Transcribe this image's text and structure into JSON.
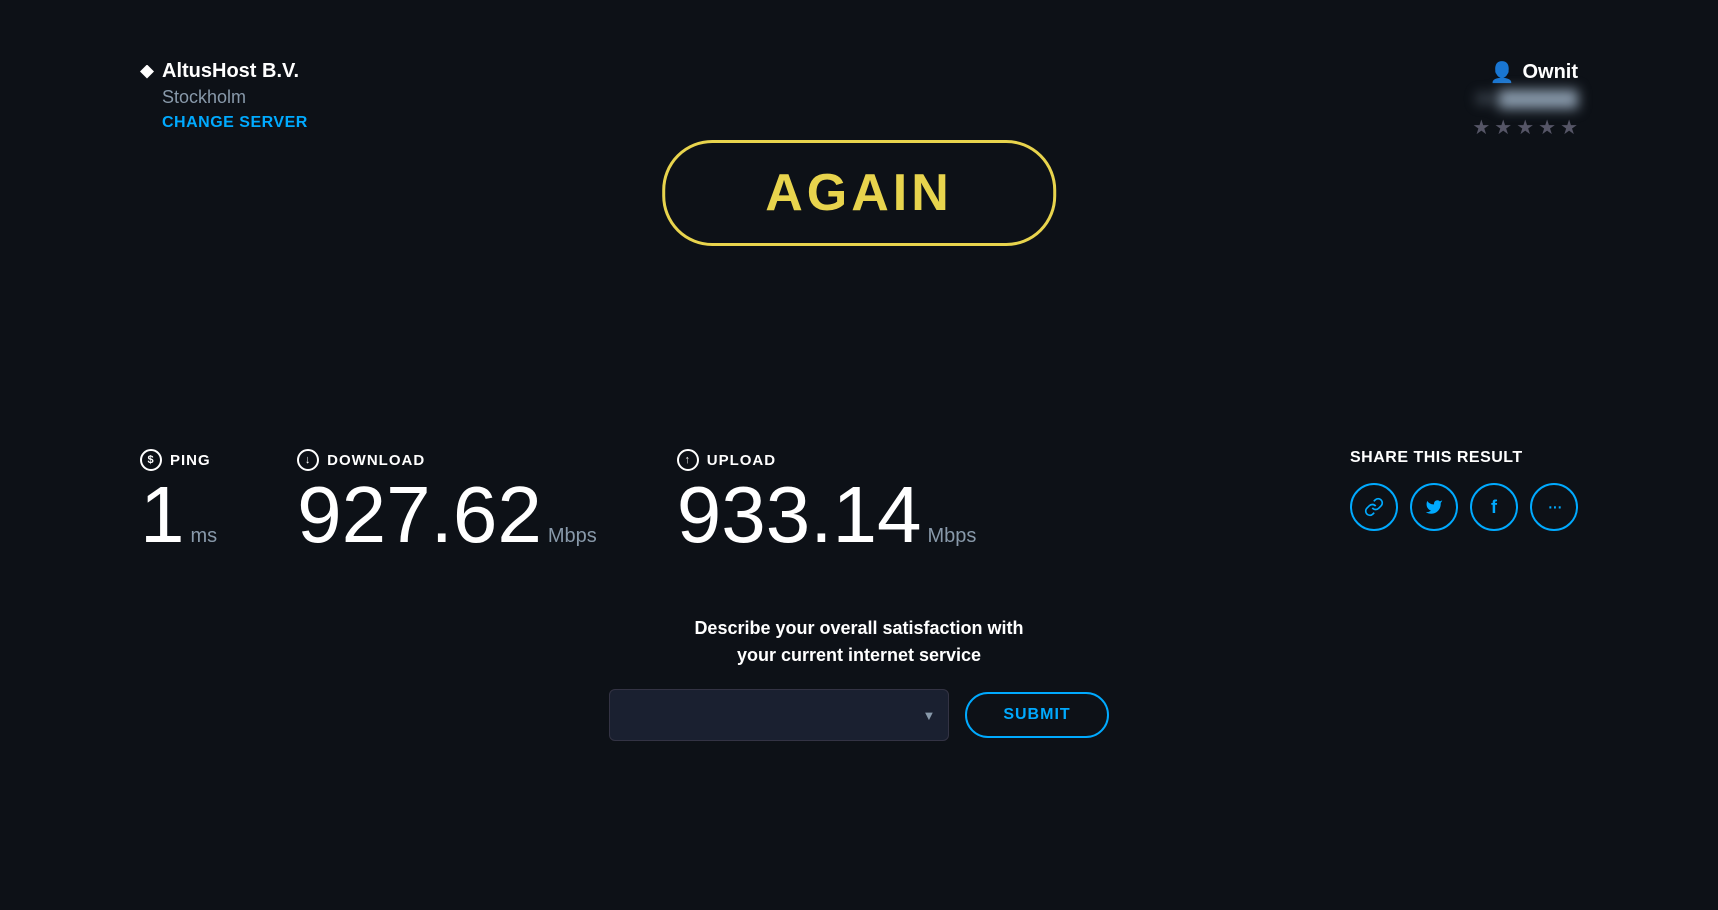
{
  "server": {
    "provider": "AltusHost B.V.",
    "location": "Stockholm",
    "change_label": "CHANGE SERVER"
  },
  "user": {
    "name": "Ownit",
    "ip": "84.███████",
    "stars": [
      "★",
      "★",
      "★",
      "★",
      "★"
    ],
    "star_filled": 2
  },
  "again_button": {
    "label": "AGAIN"
  },
  "metrics": {
    "ping": {
      "label": "PING",
      "icon": "S",
      "value": "1",
      "unit": "ms"
    },
    "download": {
      "label": "DOWNLOAD",
      "icon": "↓",
      "value": "927.62",
      "unit": "Mbps"
    },
    "upload": {
      "label": "UPLOAD",
      "icon": "↑",
      "value": "933.14",
      "unit": "Mbps"
    }
  },
  "share": {
    "label": "SHARE THIS RESULT",
    "icons": [
      "🔗",
      "🐦",
      "f",
      "···"
    ]
  },
  "satisfaction": {
    "prompt_line1": "Describe your overall satisfaction with",
    "prompt_line2": "your current internet service",
    "select_placeholder": "",
    "submit_label": "SUBMIT"
  },
  "colors": {
    "background": "#0d1117",
    "accent_yellow": "#e8d44d",
    "accent_blue": "#00aaff",
    "text_primary": "#ffffff",
    "text_muted": "#8899aa"
  }
}
